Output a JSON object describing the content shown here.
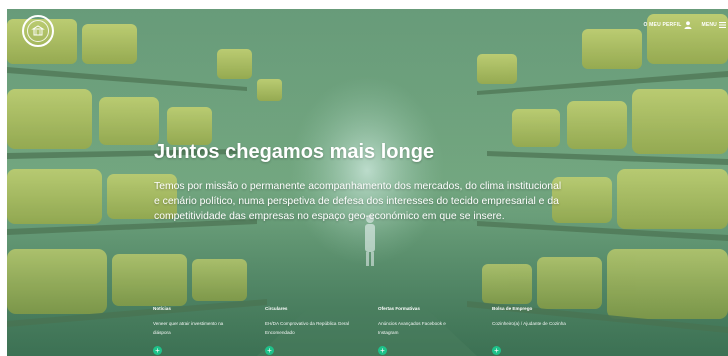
{
  "header": {
    "profile_label": "O MEU PERFIL",
    "menu_label": "MENU",
    "logo_icon": "circular-seal-logo",
    "user_icon": "user-icon",
    "menu_icon": "hamburger-icon"
  },
  "hero": {
    "title": "Juntos chegamos mais longe",
    "line1": "Temos por missão o permanente acompanhamento dos mercados, do clima institucional",
    "line2": "e cenário político, numa perspetiva de defesa dos interesses do tecido empresarial e da",
    "line3": "competitividade das empresas no espaço geo-económico em que se insere."
  },
  "cards": [
    {
      "title": "Notícias",
      "text": "Veneer quer atrair investimento na\ndiáspora",
      "button": "+"
    },
    {
      "title": "Circulares",
      "text": "EH/DA Comprovativo da República Geral\nEncomendado",
      "button": "+"
    },
    {
      "title": "Ofertas Formativas",
      "text": "Anúncios Avançados Facebook e\nInstagram",
      "button": "+"
    },
    {
      "title": "Bolsa de Emprego",
      "text": "Cozinheiro(a) / Ajudante de Cozinha",
      "button": "+"
    }
  ],
  "colors": {
    "accent": "#1ec28a",
    "overlay": "#2f7a5c"
  }
}
